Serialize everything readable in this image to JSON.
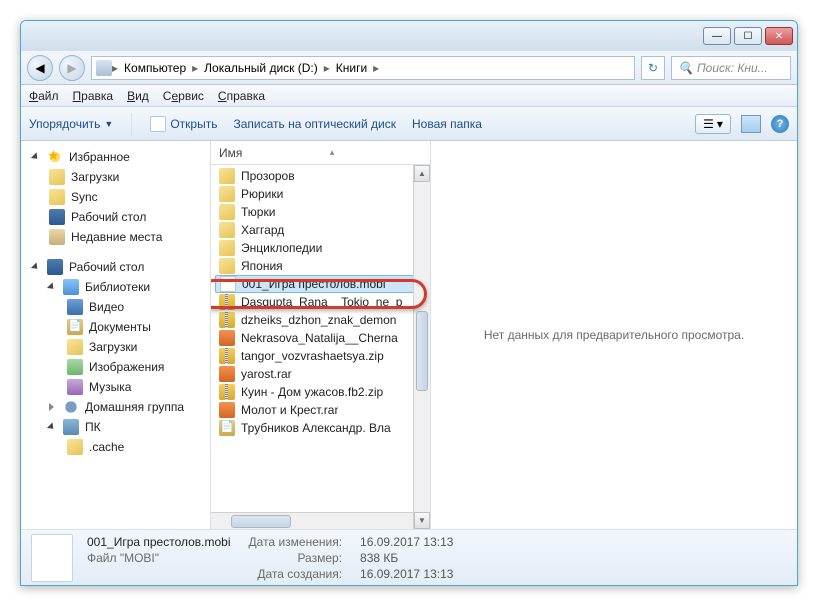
{
  "titlebar": {
    "min": "—",
    "max": "☐",
    "close": "✕"
  },
  "breadcrumb": {
    "parts": [
      "Компьютер",
      "Локальный диск (D:)",
      "Книги"
    ],
    "sep": "▸"
  },
  "search": {
    "placeholder": "Поиск: Кни..."
  },
  "menu": {
    "file": "Файл",
    "edit": "Правка",
    "view": "Вид",
    "tools": "Сервис",
    "help": "Справка"
  },
  "toolbar": {
    "organize": "Упорядочить",
    "open": "Открыть",
    "burn": "Записать на оптический диск",
    "newfolder": "Новая папка"
  },
  "sidebar": {
    "favorites": "Избранное",
    "fav_items": [
      "Загрузки",
      "Sync",
      "Рабочий стол",
      "Недавние места"
    ],
    "desktop": "Рабочий стол",
    "libs": "Библиотеки",
    "lib_items": [
      "Видео",
      "Документы",
      "Загрузки",
      "Изображения",
      "Музыка"
    ],
    "homegroup": "Домашняя группа",
    "pc": "ПК",
    "cache": ".cache"
  },
  "column": {
    "name": "Имя"
  },
  "files": [
    {
      "icon": "folder",
      "name": "Прозоров"
    },
    {
      "icon": "folder",
      "name": "Рюрики"
    },
    {
      "icon": "folder",
      "name": "Тюрки"
    },
    {
      "icon": "folder",
      "name": "Хаггард"
    },
    {
      "icon": "folder",
      "name": "Энциклопедии"
    },
    {
      "icon": "folder",
      "name": "Япония"
    },
    {
      "icon": "file",
      "name": "001_Игра престолов.mobi",
      "selected": true
    },
    {
      "icon": "zip",
      "name": "Dasgupta_Rana__Tokio_ne_p"
    },
    {
      "icon": "zip",
      "name": "dzheiks_dzhon_znak_demon"
    },
    {
      "icon": "rar",
      "name": "Nekrasova_Natalija__Cherna"
    },
    {
      "icon": "zip",
      "name": "tangor_vozvrashaetsya.zip"
    },
    {
      "icon": "rar",
      "name": "yarost.rar"
    },
    {
      "icon": "zip",
      "name": "Куин - Дом ужасов.fb2.zip"
    },
    {
      "icon": "rar",
      "name": "Молот и Крест.rar"
    },
    {
      "icon": "doc",
      "name": "Трубников Александр. Вла"
    }
  ],
  "preview": {
    "empty": "Нет данных для предварительного просмотра."
  },
  "status": {
    "filename": "001_Игра престолов.mobi",
    "type": "Файл \"MOBI\"",
    "mod_label": "Дата изменения:",
    "mod_value": "16.09.2017 13:13",
    "size_label": "Размер:",
    "size_value": "838 КБ",
    "created_label": "Дата создания:",
    "created_value": "16.09.2017 13:13"
  }
}
